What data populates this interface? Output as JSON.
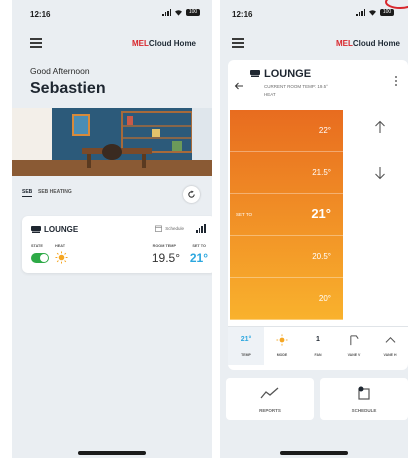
{
  "status": {
    "time": "12:16",
    "battery": "100"
  },
  "brand": {
    "mel": "MEL",
    "rest": "Cloud Home"
  },
  "home": {
    "greeting": "Good Afternoon",
    "user": "Sebastien",
    "tabs": [
      "SEB",
      "SEB HEATING"
    ],
    "unit": {
      "name": "LOUNGE",
      "schedule_label": "Schedule",
      "labels": {
        "state": "STATE",
        "heat": "HEAT",
        "room_temp": "ROOM TEMP",
        "set_to": "SET TO"
      },
      "room_temp": "19.5°",
      "set_to": "21°"
    }
  },
  "detail": {
    "title": "LOUNGE",
    "current": "CURRENT ROOM TEMP: 19.5°",
    "mode": "HEAT",
    "set_to_label": "SET TO",
    "scale": [
      "22°",
      "21.5°",
      "21°",
      "20.5°",
      "20°"
    ],
    "selected_index": 2,
    "modes": [
      {
        "main": "21°",
        "sub": "TEMP",
        "icon": ""
      },
      {
        "main": "",
        "sub": "MODE",
        "icon": "sun-icon"
      },
      {
        "main": "1",
        "sub": "FAN",
        "icon": ""
      },
      {
        "main": "",
        "sub": "VANE V",
        "icon": "vane-vertical-icon"
      },
      {
        "main": "",
        "sub": "VANE H",
        "icon": "vane-horizontal-icon"
      }
    ],
    "actions": {
      "reports": "REPORTS",
      "schedule": "SCHEDULE"
    }
  },
  "colors": {
    "accent_blue": "#2ca7df",
    "brand_red": "#d8262c",
    "toggle_green": "#2eaa47",
    "scale_top": "#e86c1f",
    "scale_bottom": "#f9b22d"
  }
}
